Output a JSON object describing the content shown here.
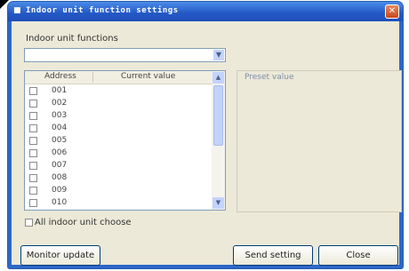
{
  "window": {
    "title": "Indoor unit function settings",
    "close_glyph": "✕"
  },
  "functions": {
    "label": "Indoor unit functions",
    "selected": ""
  },
  "list": {
    "headers": {
      "address": "Address",
      "current_value": "Current value"
    },
    "rows": [
      {
        "address": "001",
        "current_value": ""
      },
      {
        "address": "002",
        "current_value": ""
      },
      {
        "address": "003",
        "current_value": ""
      },
      {
        "address": "004",
        "current_value": ""
      },
      {
        "address": "005",
        "current_value": ""
      },
      {
        "address": "006",
        "current_value": ""
      },
      {
        "address": "007",
        "current_value": ""
      },
      {
        "address": "008",
        "current_value": ""
      },
      {
        "address": "009",
        "current_value": ""
      },
      {
        "address": "010",
        "current_value": ""
      }
    ]
  },
  "all_choose": {
    "label": "All indoor unit choose"
  },
  "preset": {
    "label": "Preset value"
  },
  "buttons": {
    "monitor_update": "Monitor update",
    "send_setting": "Send setting",
    "close": "Close"
  },
  "icons": {
    "window": "app-icon",
    "dropdown": "chevron-down-icon",
    "scroll_up": "arrow-up-icon",
    "scroll_down": "arrow-down-icon"
  }
}
